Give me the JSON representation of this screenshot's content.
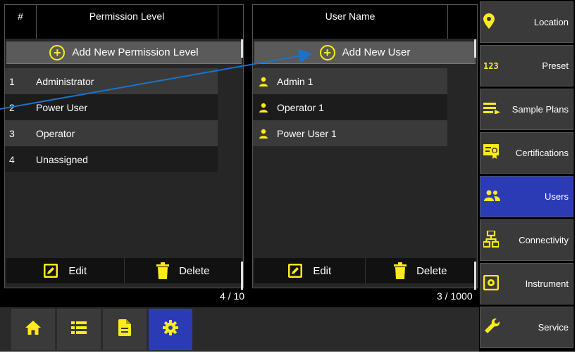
{
  "permissions": {
    "col_number": "#",
    "col_level": "Permission Level",
    "add_label": "Add New Permission Level",
    "rows": [
      {
        "num": "1",
        "name": "Administrator"
      },
      {
        "num": "2",
        "name": "Power User"
      },
      {
        "num": "3",
        "name": "Operator"
      },
      {
        "num": "4",
        "name": "Unassigned"
      }
    ],
    "edit_label": "Edit",
    "delete_label": "Delete",
    "counter": "4 / 10"
  },
  "users": {
    "col_name": "User Name",
    "add_label": "Add New User",
    "rows": [
      {
        "name": "Admin 1"
      },
      {
        "name": "Operator 1"
      },
      {
        "name": "Power User 1"
      }
    ],
    "edit_label": "Edit",
    "delete_label": "Delete",
    "counter": "3 / 1000"
  },
  "nav": {
    "items": [
      {
        "label": "Location",
        "icon": "location-pin-icon"
      },
      {
        "label": "Preset",
        "icon": "numbers-123-icon"
      },
      {
        "label": "Sample Plans",
        "icon": "sample-plans-icon"
      },
      {
        "label": "Certifications",
        "icon": "certificate-icon"
      },
      {
        "label": "Users",
        "icon": "users-icon",
        "active": true
      },
      {
        "label": "Connectivity",
        "icon": "network-icon"
      },
      {
        "label": "Instrument",
        "icon": "instrument-icon"
      },
      {
        "label": "Service",
        "icon": "wrench-icon"
      }
    ]
  },
  "bottom": {
    "buttons": [
      {
        "icon": "home-icon"
      },
      {
        "icon": "list-icon"
      },
      {
        "icon": "document-icon"
      },
      {
        "icon": "settings-gear-icon",
        "active": true
      }
    ]
  },
  "colors": {
    "accent_yellow": "#ffeb1a",
    "active_blue": "#2b3bb5",
    "annotation_arrow": "#1a73c9"
  }
}
